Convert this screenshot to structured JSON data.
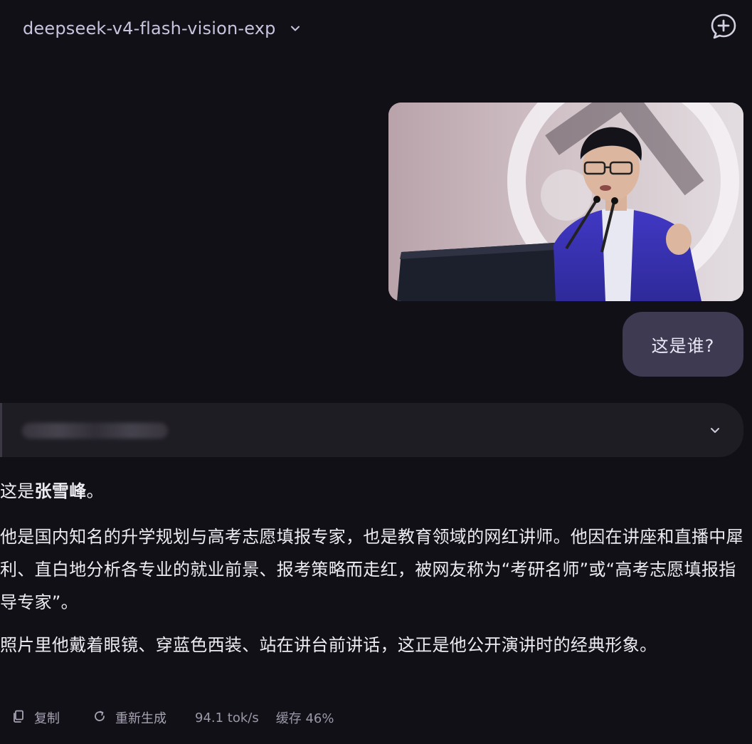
{
  "header": {
    "model_name": "deepseek-v4-flash-vision-exp",
    "model_chevron_icon": "chevron-down-icon",
    "new_chat_icon": "new-chat-plus-icon"
  },
  "user_message": {
    "image_alt": "man in blue suit speaking at podium",
    "text": "这是谁?"
  },
  "thinking": {
    "chevron_icon": "chevron-down-icon"
  },
  "answer": {
    "line1_prefix": "这是",
    "line1_name": "张雪峰",
    "line1_suffix": "。",
    "para2": "他是国内知名的升学规划与高考志愿填报专家，也是教育领域的网红讲师。他因在讲座和直播中犀利、直白地分析各专业的就业前景、报考策略而走红，被网友称为“考研名师”或“高考志愿填报指导专家”。",
    "para3": "照片里他戴着眼镜、穿蓝色西装、站在讲台前讲话，这正是他公开演讲时的经典形象。"
  },
  "actions": {
    "copy_label": "复制",
    "regenerate_label": "重新生成",
    "speed": "94.1 tok/s",
    "cache": "缓存 46%"
  },
  "colors": {
    "background": "#121017",
    "user_bubble": "#3d3a52",
    "thinking_panel": "#1f1d24",
    "suit_blue": "#3a33b8"
  }
}
